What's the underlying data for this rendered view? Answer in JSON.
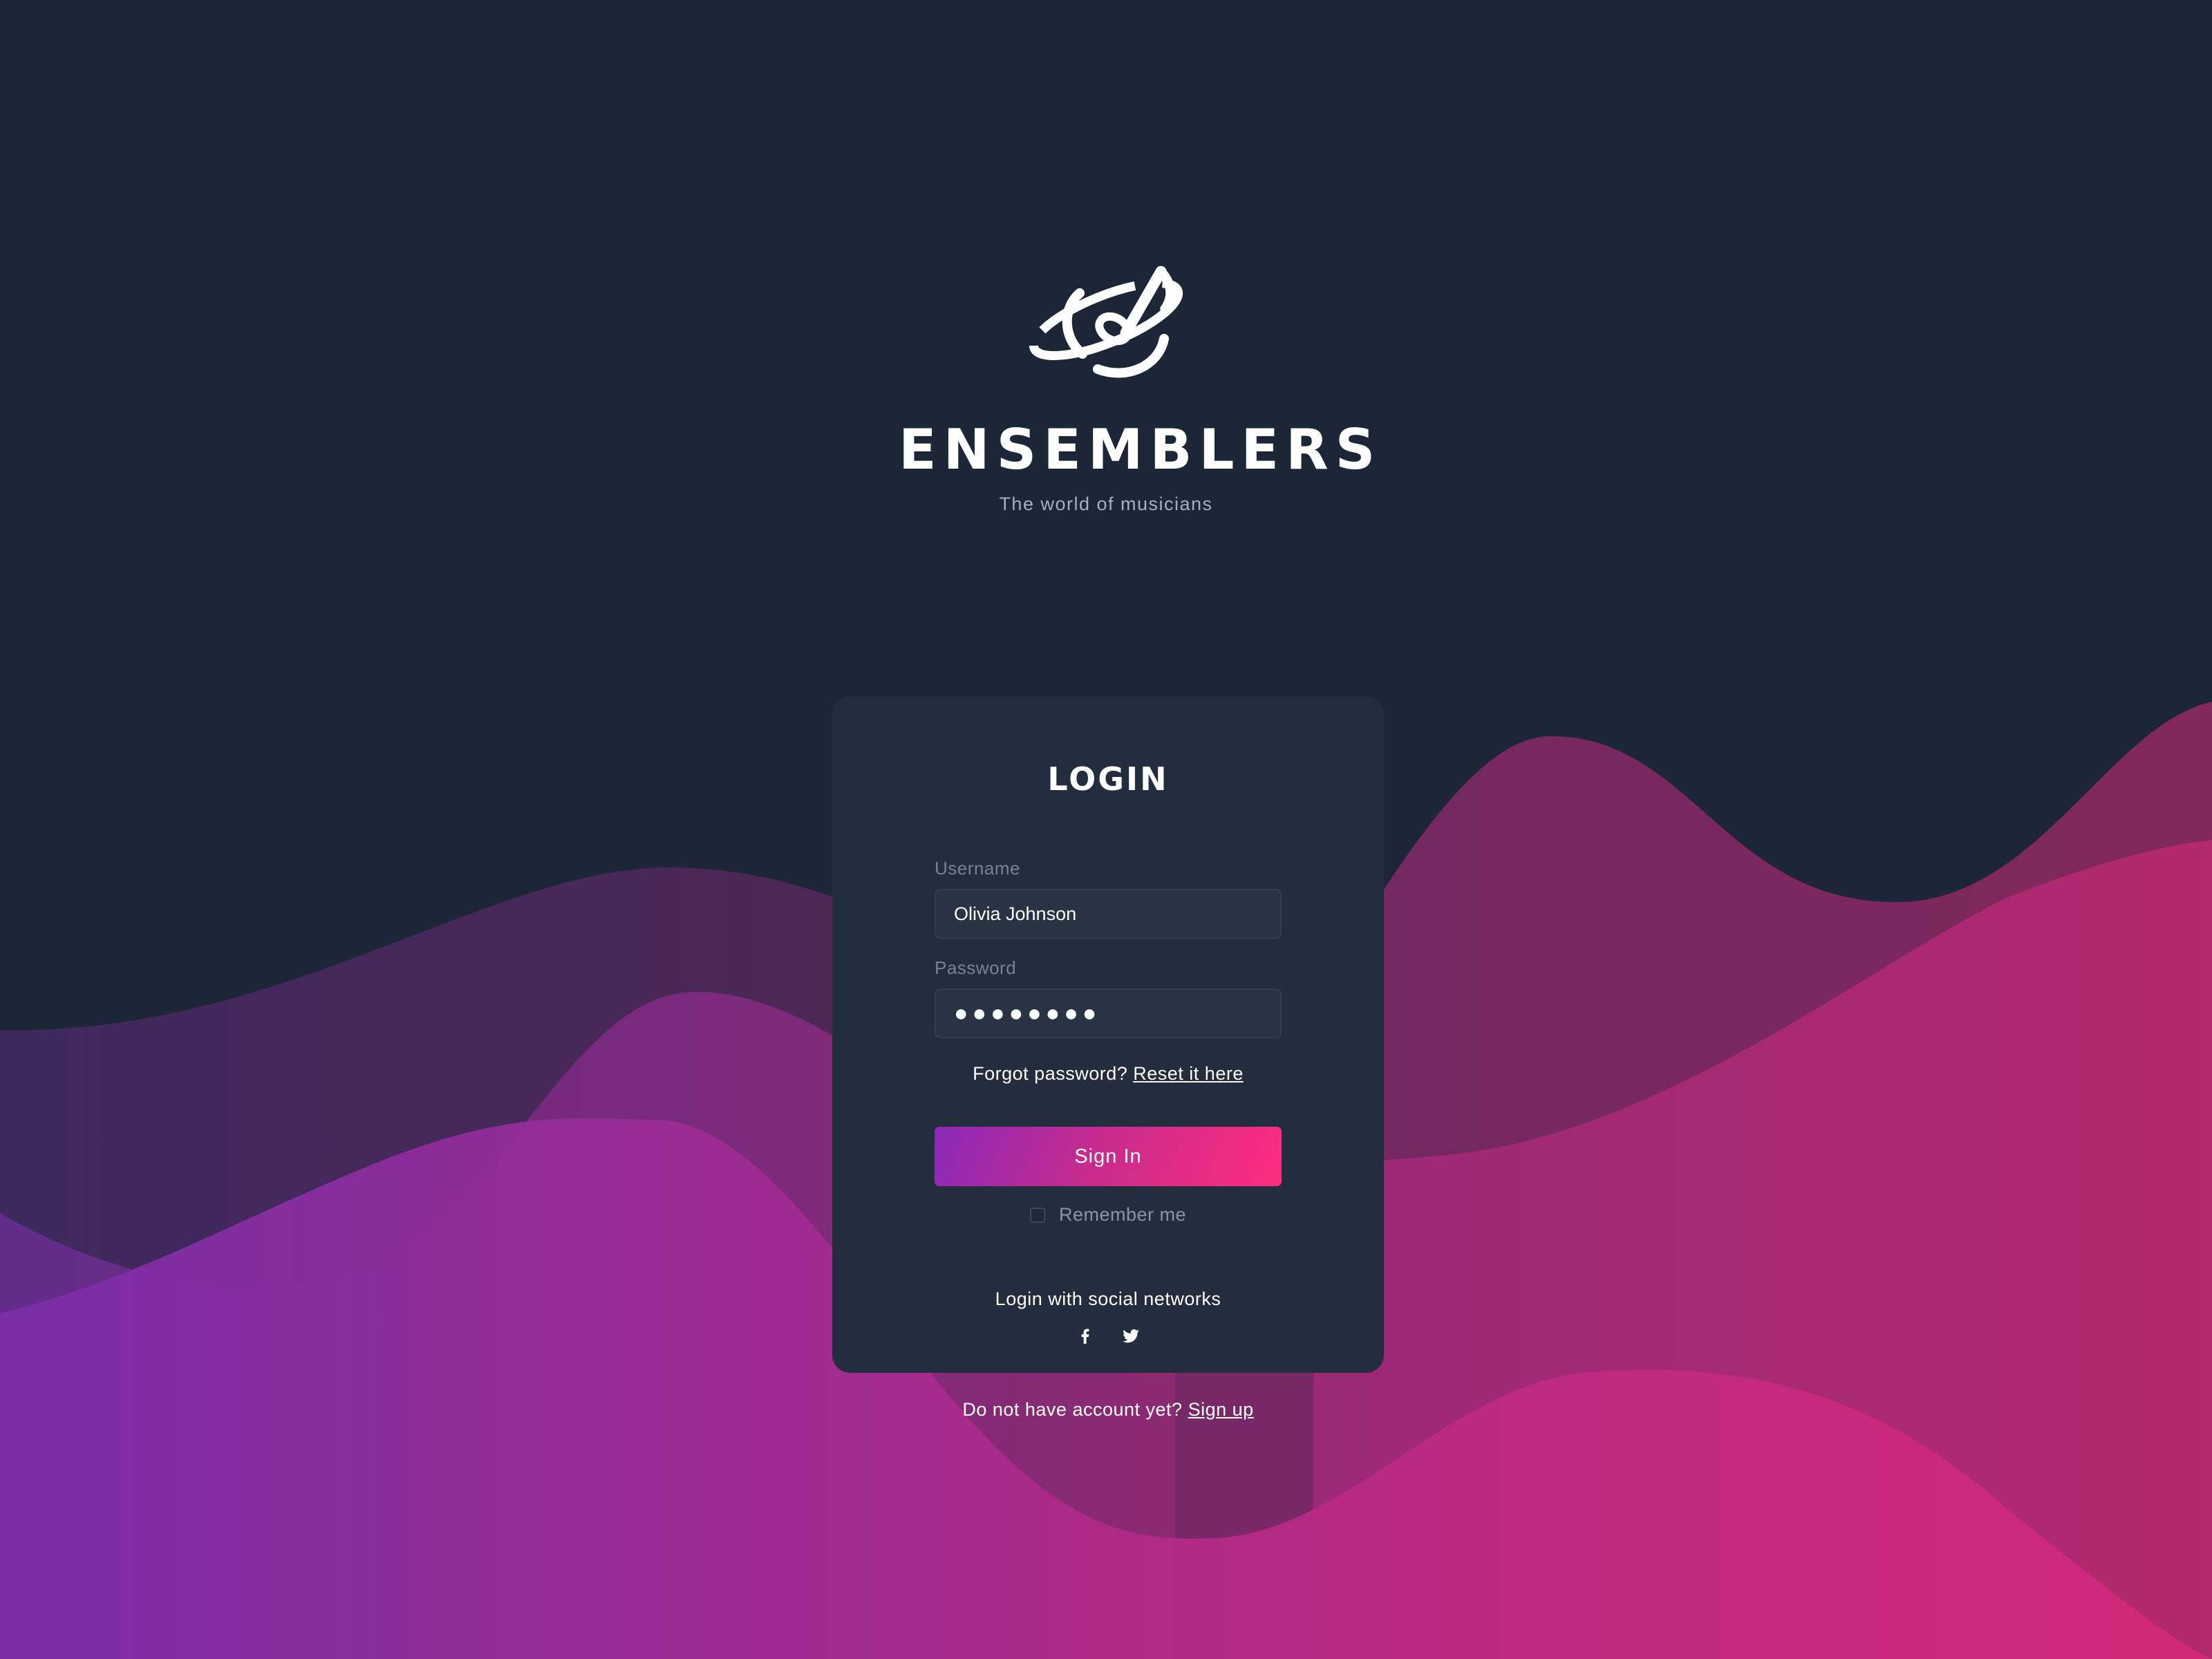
{
  "brand": {
    "name": "ENSEMBLERS",
    "tagline": "The world of musicians",
    "logo_icon": "music-note-planet-icon"
  },
  "colors": {
    "background": "#1d2636",
    "card": "#232d3e",
    "wave_purple": "#7a2ea8",
    "wave_pink": "#d4297a",
    "button_start": "#8a2ab8",
    "button_end": "#fe2d7e"
  },
  "login": {
    "title": "LOGIN",
    "username_label": "Username",
    "username_value": "Olivia Johnson",
    "password_label": "Password",
    "password_value": "●●●●●●●●",
    "forgot_text": "Forgot password?",
    "reset_link": "Reset it here",
    "signin_label": "Sign In",
    "remember_label": "Remember me",
    "remember_checked": false,
    "social_title": "Login with social networks",
    "social_icons": [
      "facebook-icon",
      "twitter-icon"
    ]
  },
  "signup": {
    "prompt": "Do not have account yet?",
    "link": "Sign up"
  }
}
